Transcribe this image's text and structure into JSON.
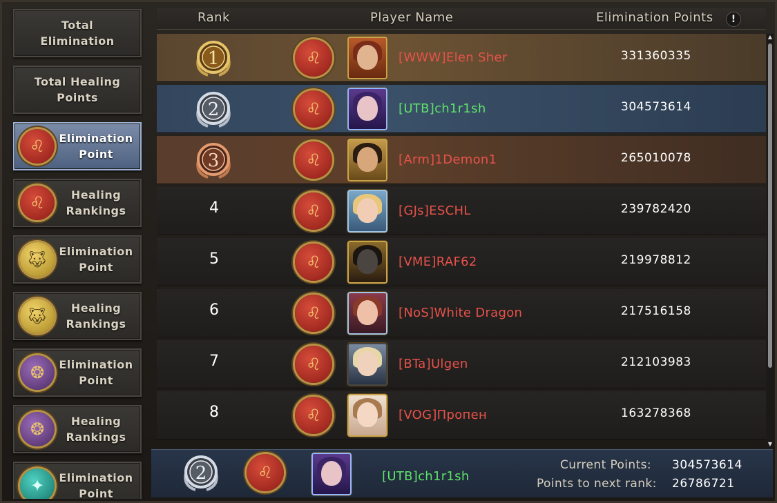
{
  "sidebar": {
    "items": [
      {
        "label": "Total\nElimination",
        "icon": null,
        "active": false
      },
      {
        "label": "Total Healing\nPoints",
        "icon": null,
        "active": false
      },
      {
        "label": "Elimination\nPoint",
        "icon": "lion-sigil-icon",
        "active": true
      },
      {
        "label": "Healing\nRankings",
        "icon": "lion-sigil-icon",
        "active": false
      },
      {
        "label": "Elimination\nPoint",
        "icon": "wolf-sigil-icon",
        "active": false
      },
      {
        "label": "Healing\nRankings",
        "icon": "wolf-sigil-icon",
        "active": false
      },
      {
        "label": "Elimination\nPoint",
        "icon": "dragon-sigil-icon",
        "active": false
      },
      {
        "label": "Healing\nRankings",
        "icon": "dragon-sigil-icon",
        "active": false
      },
      {
        "label": "Elimination\nPoint",
        "icon": "teal-sigil-icon",
        "active": false
      }
    ]
  },
  "header": {
    "rank": "Rank",
    "player_name": "Player Name",
    "points": "Elimination Points",
    "info": "!"
  },
  "rows": [
    {
      "rank": "1",
      "name": "[WWW]Elen Sher",
      "points": "331360335",
      "name_color": "red"
    },
    {
      "rank": "2",
      "name": "[UTB]ch1r1sh",
      "points": "304573614",
      "name_color": "green"
    },
    {
      "rank": "3",
      "name": "[Arm]1Demon1",
      "points": "265010078",
      "name_color": "red"
    },
    {
      "rank": "4",
      "name": "[GJs]ESCHL",
      "points": "239782420",
      "name_color": "red"
    },
    {
      "rank": "5",
      "name": "[VME]RAF62",
      "points": "219978812",
      "name_color": "red"
    },
    {
      "rank": "6",
      "name": "[NoS]White Dragon",
      "points": "217516158",
      "name_color": "red"
    },
    {
      "rank": "7",
      "name": "[BTa]Ulgen",
      "points": "212103983",
      "name_color": "red"
    },
    {
      "rank": "8",
      "name": "[VOG]Пропен",
      "points": "163278368",
      "name_color": "red"
    }
  ],
  "footer": {
    "rank": "2",
    "name": "[UTB]ch1r1sh",
    "current_points_label": "Current Points:",
    "current_points": "304573614",
    "next_rank_label": "Points to next rank:",
    "next_rank_points": "26786721"
  },
  "colors": {
    "accent_gold": "#c9a44c",
    "name_red": "#e8524a",
    "name_green": "#5fe36a",
    "active_tab": "#6f83a3"
  }
}
